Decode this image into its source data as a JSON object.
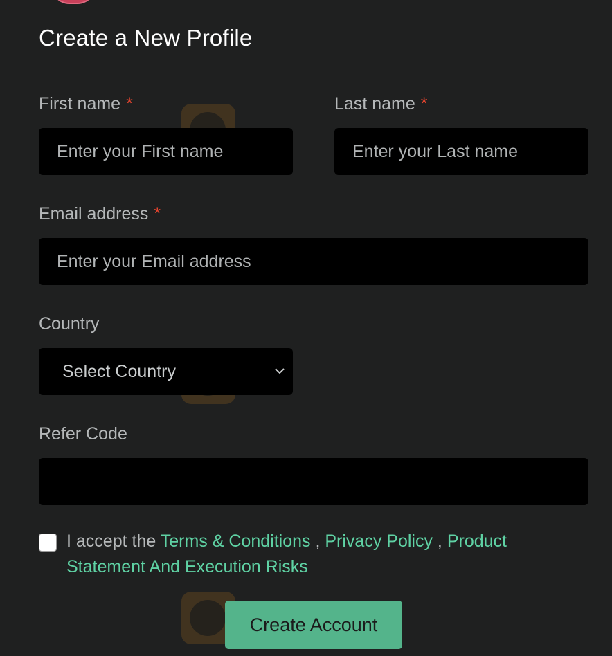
{
  "form": {
    "title": "Create a New Profile",
    "first_name": {
      "label": "First name",
      "required_mark": "*",
      "placeholder": "Enter your First name"
    },
    "last_name": {
      "label": "Last name",
      "required_mark": "*",
      "placeholder": "Enter your Last name"
    },
    "email": {
      "label": "Email address",
      "required_mark": "*",
      "placeholder": "Enter your Email address"
    },
    "country": {
      "label": "Country",
      "selected": "Select Country"
    },
    "refer_code": {
      "label": "Refer Code",
      "value": ""
    },
    "terms": {
      "prefix": "I accept the",
      "sep1": ",",
      "sep2": ",",
      "links": [
        "Terms & Conditions",
        "Privacy Policy",
        "Product Statement And Execution Risks"
      ]
    },
    "submit_label": "Create Account"
  },
  "colors": {
    "background": "#1f2020",
    "input_bg": "#000000",
    "accent": "#5fd2a4",
    "button": "#54b48b",
    "required": "#e8452f"
  },
  "icons": {
    "select_arrow": "chevron-down-icon",
    "avatar": "avatar"
  }
}
